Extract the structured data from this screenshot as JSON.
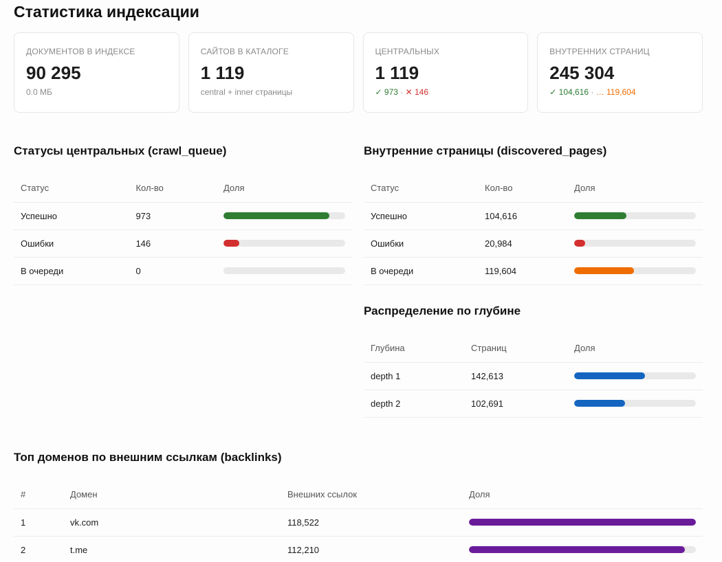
{
  "page": {
    "title": "Статистика индексации"
  },
  "cards": [
    {
      "label": "Документов в индексе",
      "value": "90 295",
      "sub": "0.0 МБ"
    },
    {
      "label": "Сайтов в каталоге",
      "value": "1 119",
      "sub": "central + inner страницы"
    },
    {
      "label": "Центральных",
      "value": "1 119",
      "sub_ok": "✓ 973",
      "sub_sep": " · ",
      "sub_err": "✕ 146"
    },
    {
      "label": "Внутренних страниц",
      "value": "245 304",
      "sub_ok": "✓ 104,616",
      "sub_sep": " · ",
      "sub_pend": "… 119,604"
    }
  ],
  "central": {
    "title": "Статусы центральных (crawl_queue)",
    "headers": [
      "Статус",
      "Кол-во",
      "Доля"
    ],
    "rows": [
      {
        "status": "Успешно",
        "count": "973",
        "share": 0.87
      },
      {
        "status": "Ошибки",
        "count": "146",
        "share": 0.13
      },
      {
        "status": "В очереди",
        "count": "0",
        "share": 0
      }
    ]
  },
  "inner": {
    "title": "Внутренние страницы (discovered_pages)",
    "headers": [
      "Статус",
      "Кол-во",
      "Доля"
    ],
    "rows": [
      {
        "status": "Успешно",
        "count": "104,616",
        "share": 0.43
      },
      {
        "status": "Ошибки",
        "count": "20,984",
        "share": 0.09
      },
      {
        "status": "В очереди",
        "count": "119,604",
        "share": 0.49
      }
    ]
  },
  "depth": {
    "title": "Распределение по глубине",
    "headers": [
      "Глубина",
      "Страниц",
      "Доля"
    ],
    "rows": [
      {
        "depth": "depth 1",
        "pages": "142,613",
        "share": 0.58
      },
      {
        "depth": "depth 2",
        "pages": "102,691",
        "share": 0.42
      }
    ]
  },
  "backlinks": {
    "title": "Топ доменов по внешним ссылкам (backlinks)",
    "headers": [
      "#",
      "Домен",
      "Внешних ссылок",
      "Доля"
    ],
    "rows": [
      {
        "rank": "1",
        "domain": "vk.com",
        "links": "118,522",
        "share": 1.0
      },
      {
        "rank": "2",
        "domain": "t.me",
        "links": "112,210",
        "share": 0.95
      }
    ]
  },
  "colors": {
    "success": "#2e7d32",
    "error": "#d32f2f",
    "pending": "#ef6c00",
    "depth": "#1565c0",
    "backlinks": "#6a1b9a"
  }
}
